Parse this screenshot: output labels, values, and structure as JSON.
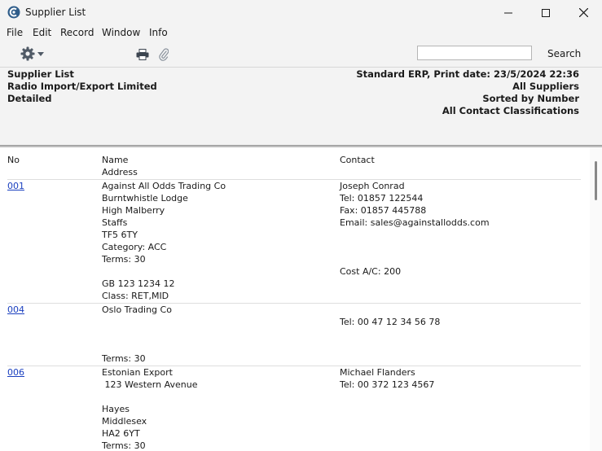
{
  "window": {
    "title": "Supplier List"
  },
  "menu": [
    "File",
    "Edit",
    "Record",
    "Window",
    "Info"
  ],
  "toolbar": {
    "search_value": "",
    "search_label": "Search"
  },
  "report_header": {
    "left": [
      "Supplier List",
      "Radio Import/Export Limited",
      "Detailed"
    ],
    "right": [
      "Standard ERP, Print date: 23/5/2024 22:36",
      "All Suppliers",
      "Sorted by Number",
      "All Contact Classifications"
    ]
  },
  "columns": {
    "no": "No",
    "name": "Name",
    "address": "Address",
    "contact": "Contact"
  },
  "suppliers": [
    {
      "no": "001",
      "name_lines": [
        "Against All Odds Trading Co",
        "Burntwhistle Lodge",
        "High Malberry",
        "Staffs",
        "TF5 6TY",
        "Category: ACC",
        "Terms: 30",
        "",
        "GB 123 1234 12",
        "Class: RET,MID"
      ],
      "contact_lines": [
        "Joseph Conrad",
        "Tel: 01857 122544",
        "Fax: 01857 445788",
        "Email: sales@againstallodds.com",
        "",
        "",
        "",
        "Cost A/C: 200"
      ]
    },
    {
      "no": "004",
      "name_lines": [
        "Oslo Trading Co",
        "",
        "",
        "",
        "Terms: 30"
      ],
      "contact_lines": [
        "",
        "Tel: 00 47 12 34 56 78"
      ]
    },
    {
      "no": "006",
      "name_lines": [
        "Estonian Export",
        " 123 Western Avenue",
        "",
        "Hayes",
        "Middlesex",
        "HA2 6YT",
        "Terms: 30"
      ],
      "contact_lines": [
        "Michael Flanders",
        "Tel: 00 372 123 4567"
      ]
    }
  ]
}
